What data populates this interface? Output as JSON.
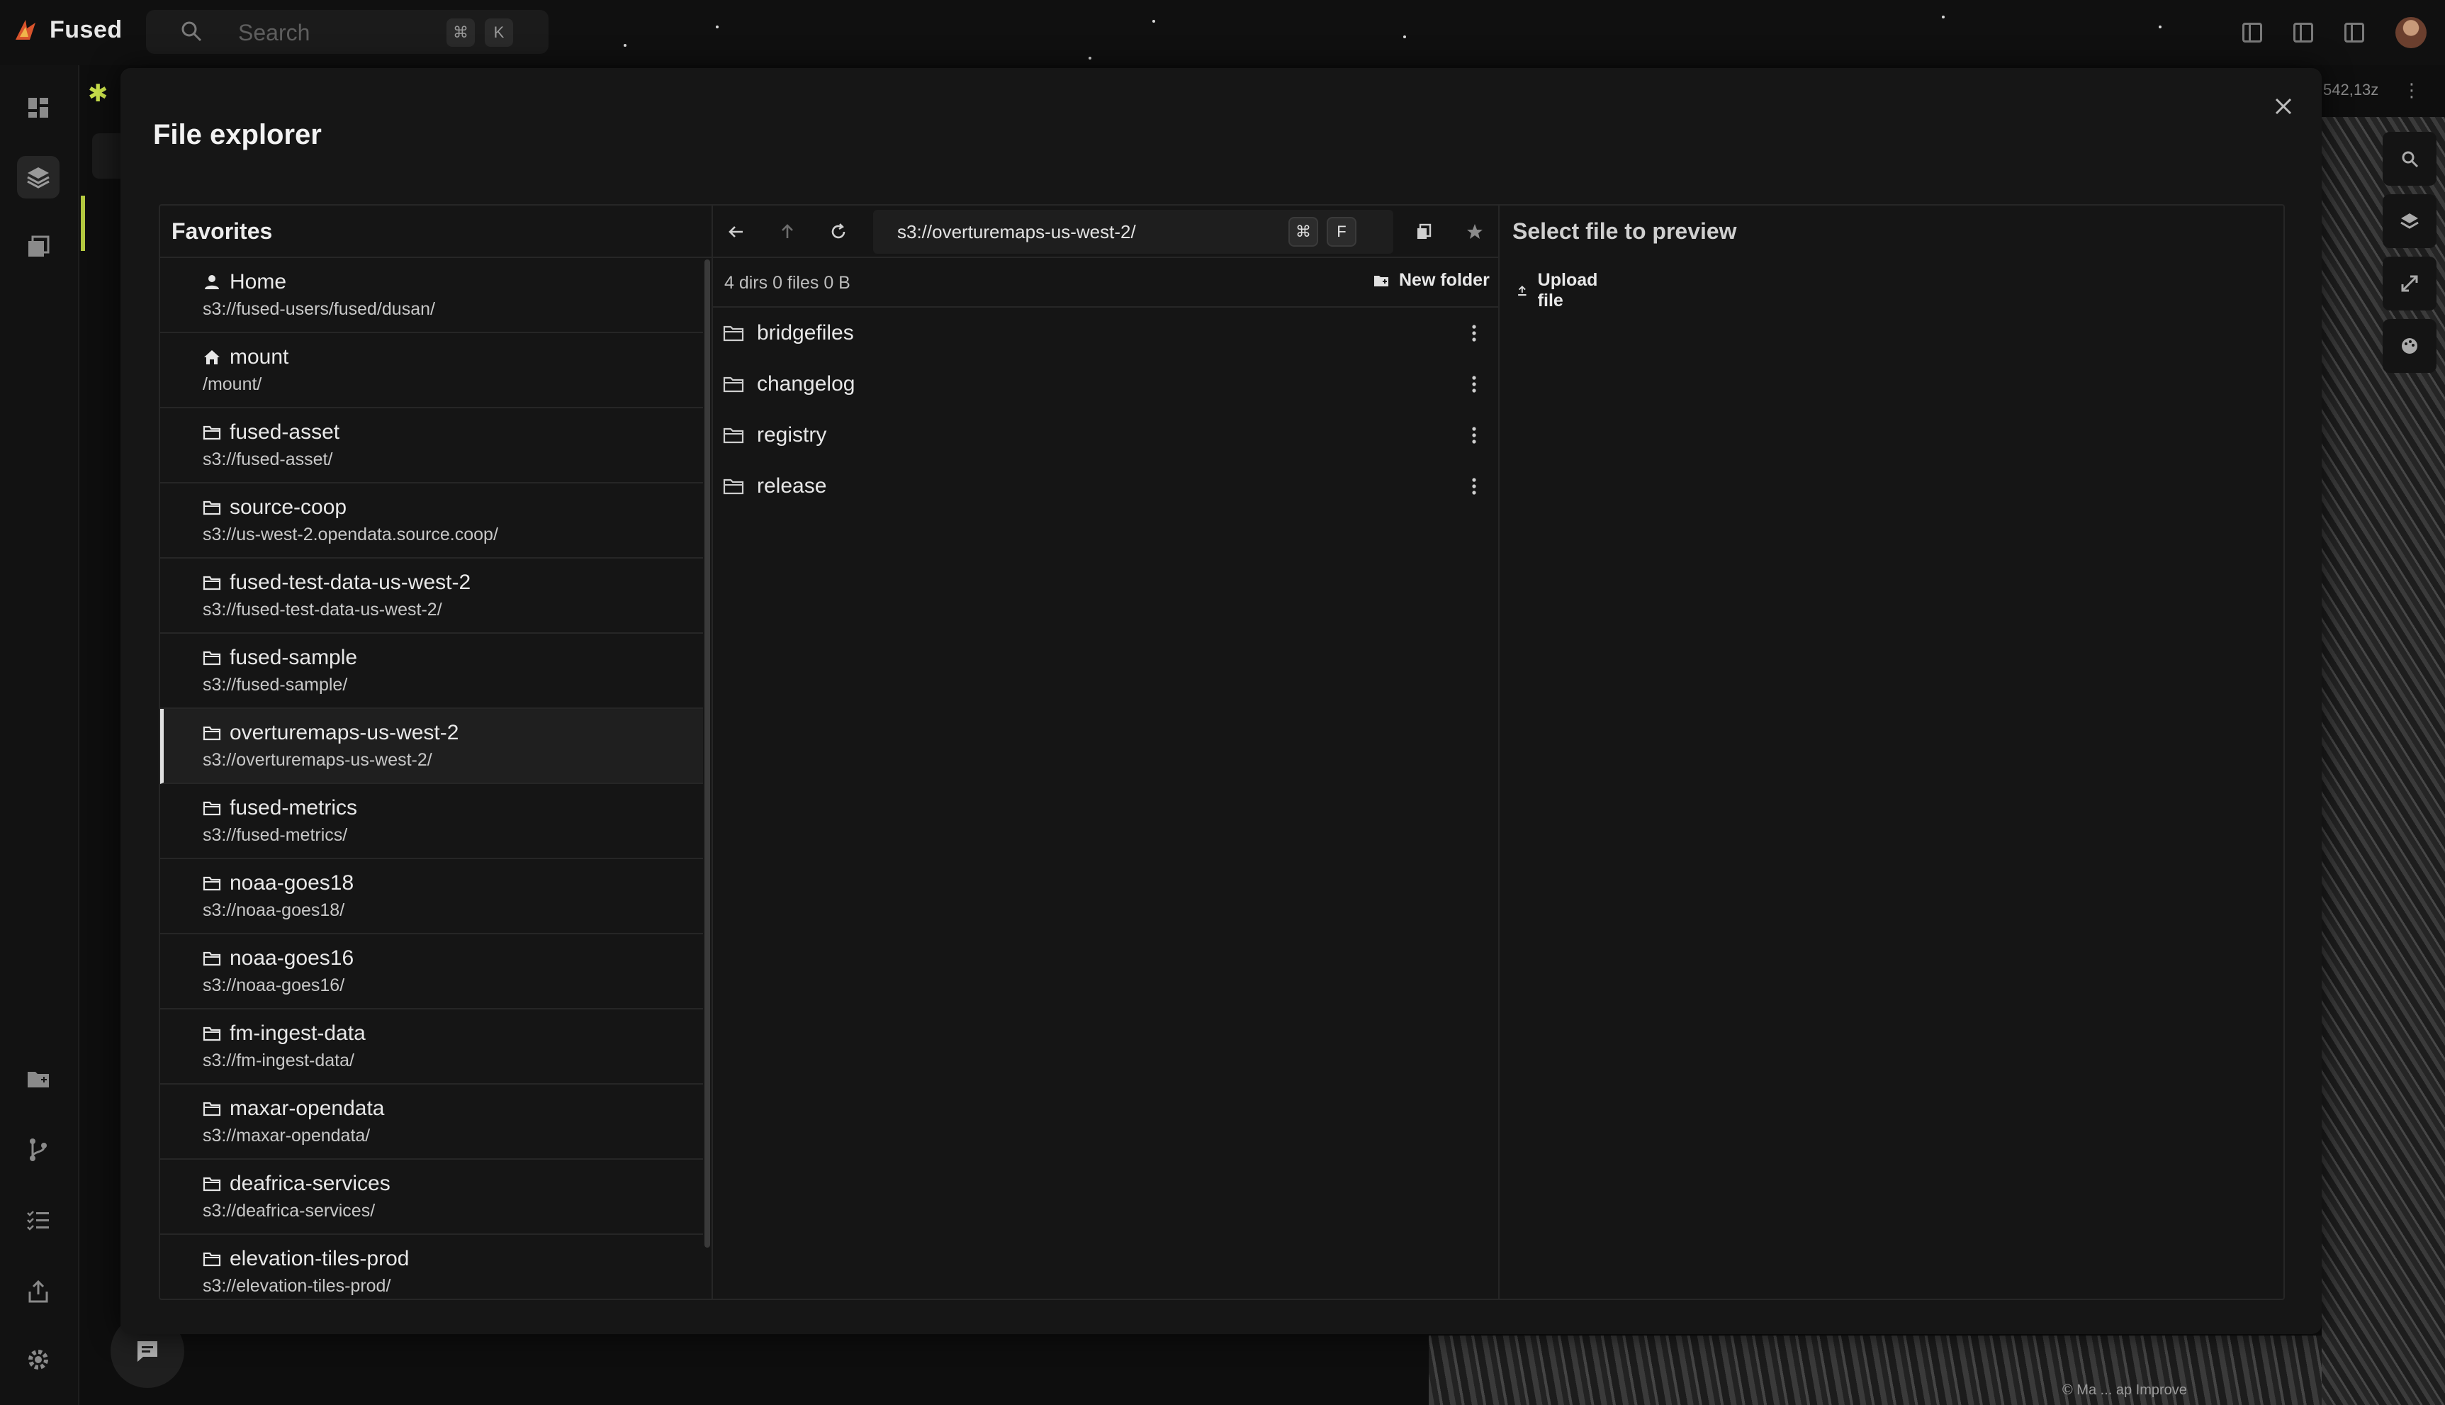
{
  "app": {
    "name": "Fused",
    "search_placeholder": "Search",
    "search_kbd_cmd": "⌘",
    "search_kbd_key": "K"
  },
  "map": {
    "coords": "542,13z",
    "attribution": "© Ma ... ap Improve"
  },
  "modal": {
    "title": "File explorer"
  },
  "favorites": {
    "header": "Favorites",
    "items": [
      {
        "name": "Home",
        "path": "s3://fused-users/fused/dusan/",
        "icon": "user-icon"
      },
      {
        "name": "mount",
        "path": "/mount/",
        "icon": "home-icon"
      },
      {
        "name": "fused-asset",
        "path": "s3://fused-asset/",
        "icon": "folder-icon"
      },
      {
        "name": "source-coop",
        "path": "s3://us-west-2.opendata.source.coop/",
        "icon": "folder-icon"
      },
      {
        "name": "fused-test-data-us-west-2",
        "path": "s3://fused-test-data-us-west-2/",
        "icon": "folder-icon"
      },
      {
        "name": "fused-sample",
        "path": "s3://fused-sample/",
        "icon": "folder-icon"
      },
      {
        "name": "overturemaps-us-west-2",
        "path": "s3://overturemaps-us-west-2/",
        "icon": "folder-icon"
      },
      {
        "name": "fused-metrics",
        "path": "s3://fused-metrics/",
        "icon": "folder-icon"
      },
      {
        "name": "noaa-goes18",
        "path": "s3://noaa-goes18/",
        "icon": "folder-icon"
      },
      {
        "name": "noaa-goes16",
        "path": "s3://noaa-goes16/",
        "icon": "folder-icon"
      },
      {
        "name": "fm-ingest-data",
        "path": "s3://fm-ingest-data/",
        "icon": "folder-icon"
      },
      {
        "name": "maxar-opendata",
        "path": "s3://maxar-opendata/",
        "icon": "folder-icon"
      },
      {
        "name": "deafrica-services",
        "path": "s3://deafrica-services/",
        "icon": "folder-icon"
      },
      {
        "name": "elevation-tiles-prod",
        "path": "s3://elevation-tiles-prod/",
        "icon": "folder-icon"
      }
    ],
    "selected_index": 6
  },
  "browser": {
    "path": "s3://overturemaps-us-west-2/",
    "kbd_cmd": "⌘",
    "kbd_key": "F",
    "stats": "4 dirs 0 files 0 B",
    "new_folder_label": "New folder",
    "upload_label": "Upload file",
    "dirs": [
      {
        "name": "bridgefiles"
      },
      {
        "name": "changelog"
      },
      {
        "name": "registry"
      },
      {
        "name": "release"
      }
    ]
  },
  "preview": {
    "placeholder": "Select file to preview"
  },
  "colors": {
    "background": "#0e0e0e",
    "modal": "#161616",
    "border": "#262626",
    "accent": "#b3c83f"
  }
}
